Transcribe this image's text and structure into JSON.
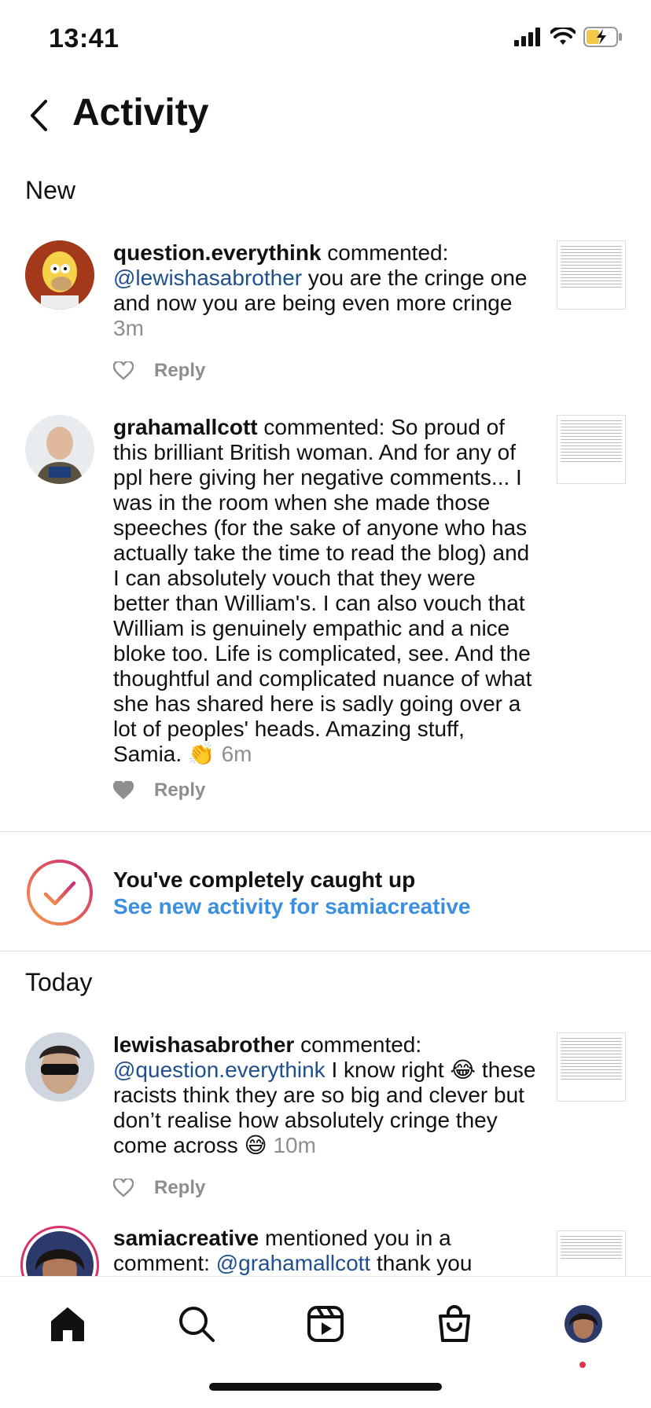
{
  "status_bar": {
    "time": "13:41"
  },
  "header": {
    "title": "Activity"
  },
  "sections": {
    "new": "New",
    "today": "Today"
  },
  "items": [
    {
      "user": "question.everythink",
      "action": " commented: ",
      "mention": "@lewishasabrother",
      "text": " you are the cringe one and now you are being even more cringe ",
      "time": "3m",
      "reply": "Reply",
      "liked": false
    },
    {
      "user": "grahamallcott",
      "action": " commented: ",
      "mention": "",
      "text": "So proud of this brilliant British woman. And for any of ppl here giving her negative comments... I was in the room when she made those speeches (for the sake of anyone who has actually take the time to read the blog) and I can absolutely vouch that they were better than William's. I can also vouch that William is genuinely empathic and a nice bloke too. Life is complicated, see. And the thoughtful and complicated nuance of what she has shared here is sadly going over a lot of peoples' heads. Amazing stuff, Samia. 👏 ",
      "time": "6m",
      "reply": "Reply",
      "liked": true
    },
    {
      "user": "lewishasabrother",
      "action": " commented: ",
      "mention": "@question.everythink",
      "text": " I know right 😂 these racists think they are so big and clever but don’t realise how absolutely cringe they come across 😅 ",
      "time": "10m",
      "reply": "Reply",
      "liked": false
    },
    {
      "user": "samiacreative",
      "action": " mentioned you in a comment: ",
      "mention": "@grahamallcott",
      "text": " thank you",
      "time": "",
      "reply": "",
      "liked": false
    }
  ],
  "caught_up": {
    "title": "You've completely caught up",
    "link": "See new activity for samiacreative"
  },
  "tab_bar": {
    "icons": [
      "home-icon",
      "search-icon",
      "reels-icon",
      "shop-icon",
      "profile-avatar"
    ]
  },
  "colors": {
    "link_blue": "#3b8fe0",
    "mention_blue": "#1e4f8f",
    "muted": "#8e8e8e"
  }
}
